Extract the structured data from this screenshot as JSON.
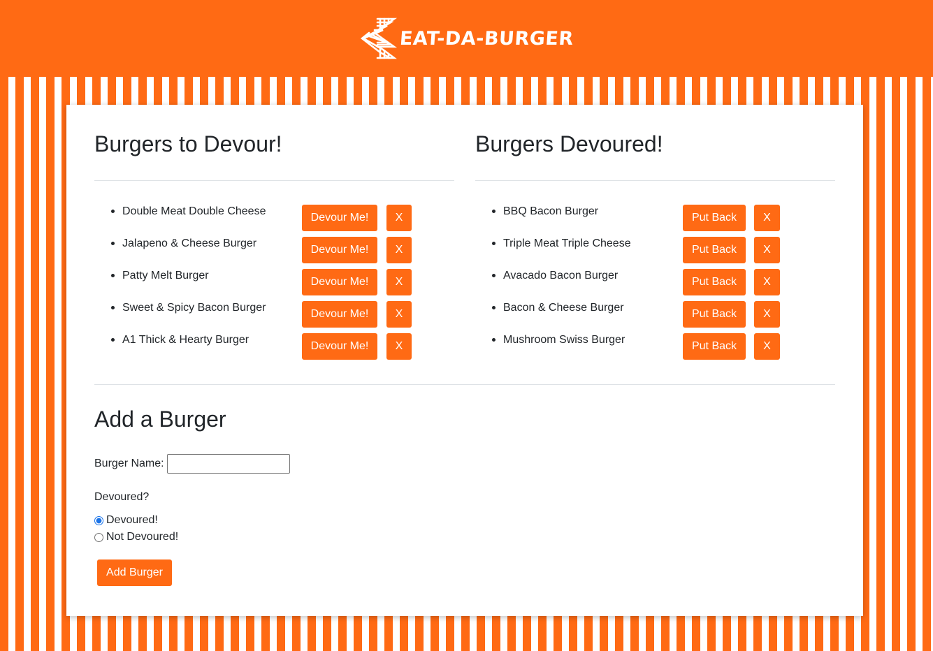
{
  "brand": {
    "name": "EAT-DA-BURGER",
    "accent_color": "#ff6a14"
  },
  "to_devour": {
    "title": "Burgers to Devour!",
    "action_label": "Devour Me!",
    "delete_label": "X",
    "items": [
      "Double Meat Double Cheese",
      "Jalapeno & Cheese Burger",
      "Patty Melt Burger",
      "Sweet & Spicy Bacon Burger",
      "A1 Thick & Hearty Burger"
    ]
  },
  "devoured": {
    "title": "Burgers Devoured!",
    "action_label": "Put Back",
    "delete_label": "X",
    "items": [
      "BBQ Bacon Burger",
      "Triple Meat Triple Cheese",
      "Avacado Bacon Burger",
      "Bacon & Cheese Burger",
      "Mushroom Swiss Burger"
    ]
  },
  "add_form": {
    "title": "Add a Burger",
    "name_label": "Burger Name:",
    "name_value": "",
    "devoured_question": "Devoured?",
    "option_devoured": "Devoured!",
    "option_not_devoured": "Not Devoured!",
    "selected_option": "Devoured!",
    "submit_label": "Add Burger"
  }
}
